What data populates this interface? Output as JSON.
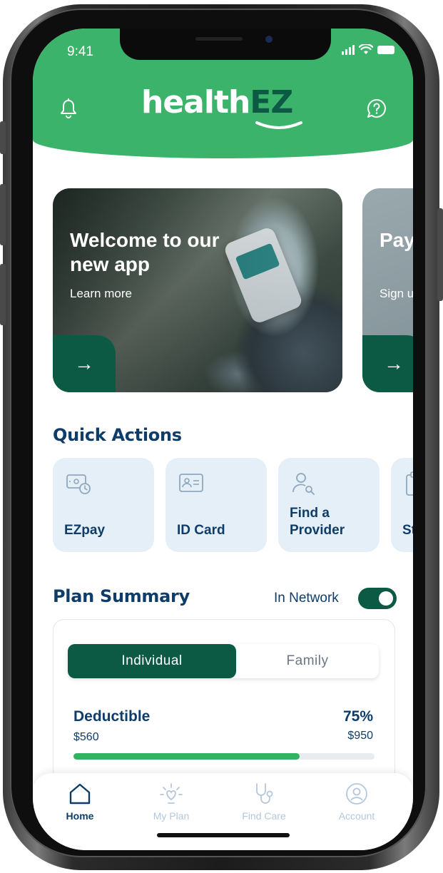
{
  "status_bar": {
    "time": "9:41"
  },
  "header": {
    "logo_left": "health",
    "logo_right": "EZ",
    "brand_color": "#3cb36a",
    "accent_color": "#0d5a44"
  },
  "carousel": [
    {
      "title": "Welcome to our new app",
      "subtitle": "Learn more",
      "arrow": "→"
    },
    {
      "title": "Pay way",
      "subtitle": "Sign u",
      "arrow": "→"
    }
  ],
  "quick_actions": {
    "title": "Quick Actions",
    "items": [
      {
        "label": "EZpay",
        "icon": "payment-clock-icon"
      },
      {
        "label": "ID Card",
        "icon": "id-card-icon"
      },
      {
        "label": "Find a Provider",
        "icon": "person-search-icon"
      },
      {
        "label": "St",
        "icon": "clipboard-icon"
      }
    ]
  },
  "plan_summary": {
    "title": "Plan Summary",
    "network_label": "In Network",
    "network_on": true,
    "tabs": {
      "active": "Individual",
      "inactive": "Family"
    },
    "deductible": {
      "label": "Deductible",
      "percent_text": "75%",
      "spent": "$560",
      "total": "$950",
      "progress": 0.75
    }
  },
  "nav": [
    {
      "label": "Home",
      "icon": "home-icon",
      "active": true
    },
    {
      "label": "My Plan",
      "icon": "heart-sparkle-icon",
      "active": false
    },
    {
      "label": "Find Care",
      "icon": "stethoscope-icon",
      "active": false
    },
    {
      "label": "Account",
      "icon": "account-icon",
      "active": false
    }
  ]
}
